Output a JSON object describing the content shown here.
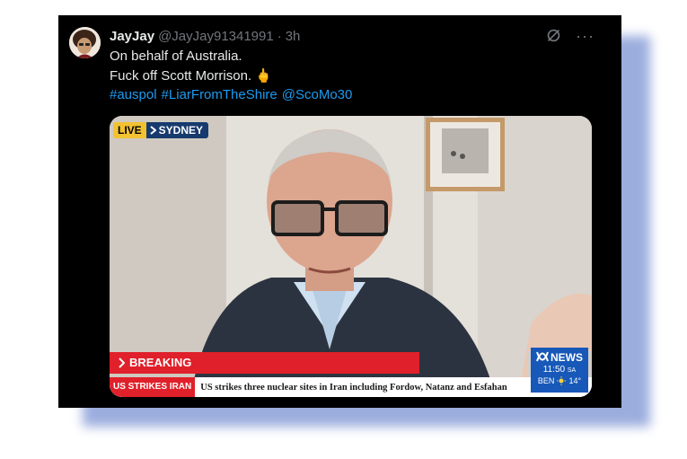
{
  "tweet": {
    "author_name": "JayJay",
    "handle": "@JayJay91341991",
    "separator": "·",
    "time": "3h",
    "line1": "On behalf of Australia.",
    "line2": "Fuck off Scott Morrison.",
    "emoji": "🖕",
    "hashtags": [
      "#auspol",
      "#LiarFromTheShire",
      "@ScoMo30"
    ]
  },
  "video": {
    "live_label": "LIVE",
    "location_label": "SYDNEY",
    "breaking_label": "BREAKING",
    "ticker_label": "US STRIKES IRAN",
    "ticker_text": "US strikes three nuclear sites in Iran including Fordow, Natanz and Esfahan",
    "network_name": "NEWS",
    "network_time": "11:50",
    "network_time_suffix": "SA",
    "weather_city": "BEN",
    "weather_temp": "14°"
  },
  "colors": {
    "card_bg": "#000000",
    "link": "#1d9bf0",
    "breaking_red": "#e0202a",
    "abc_blue": "#1758b8",
    "shadow": "#8a9fd8"
  },
  "icons": [
    "grok-icon",
    "more-icon",
    "chevron-right-icon",
    "sun-icon",
    "abc-logo-icon"
  ]
}
